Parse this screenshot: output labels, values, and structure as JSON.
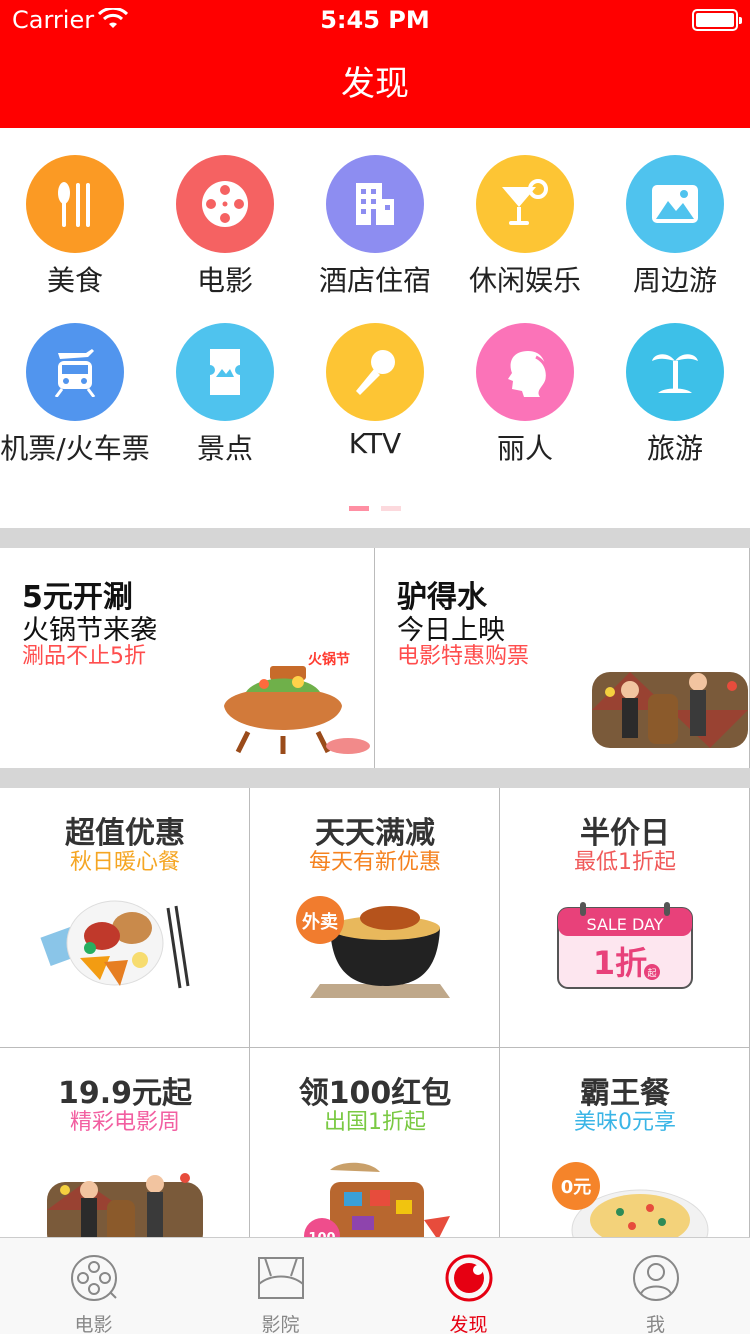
{
  "status_bar": {
    "carrier": "Carrier",
    "time": "5:45 PM"
  },
  "nav": {
    "title": "发现"
  },
  "categories": [
    {
      "label": "美食",
      "icon": "fork-knife-icon",
      "color": "#fb9a24"
    },
    {
      "label": "电影",
      "icon": "film-reel-icon",
      "color": "#f56262"
    },
    {
      "label": "酒店住宿",
      "icon": "hotel-icon",
      "color": "#8d8df1"
    },
    {
      "label": "休闲娱乐",
      "icon": "cocktail-icon",
      "color": "#fdc534"
    },
    {
      "label": "周边游",
      "icon": "landscape-icon",
      "color": "#4fc3ee"
    },
    {
      "label": "机票/火车票",
      "icon": "plane-train-icon",
      "color": "#5195ee"
    },
    {
      "label": "景点",
      "icon": "ticket-icon",
      "color": "#4fc3ee"
    },
    {
      "label": "KTV",
      "icon": "microphone-icon",
      "color": "#fdc534"
    },
    {
      "label": "丽人",
      "icon": "woman-profile-icon",
      "color": "#fb73b8"
    },
    {
      "label": "旅游",
      "icon": "palm-tree-icon",
      "color": "#3dc0e8"
    }
  ],
  "page_indicator": {
    "current": 1,
    "total": 2,
    "active_color": "#ff8fa3",
    "inactive_color": "#fcd9dd"
  },
  "promos": [
    {
      "title": "5元开涮",
      "subtitle": "火锅节来袭",
      "note": "涮品不止5折",
      "image": "hotpot-image",
      "image_caption": "火锅节"
    },
    {
      "title": "驴得水",
      "subtitle": "今日上映",
      "note": "电影特惠购票",
      "image": "movie-poster-image"
    }
  ],
  "deals": [
    {
      "title": "超值优惠",
      "subtitle": "秋日暖心餐",
      "color": "#f5a623",
      "image": "meal-plate-image"
    },
    {
      "title": "天天满减",
      "subtitle": "每天有新优惠",
      "color": "#f5821f",
      "image": "takeout-noodle-image",
      "badge": "外卖"
    },
    {
      "title": "半价日",
      "subtitle": "最低1折起",
      "color": "#f05a5a",
      "image": "sale-day-calendar-image",
      "card_top": "SALE DAY",
      "card_main": "1折",
      "card_small": "起"
    },
    {
      "title": "19.9元起",
      "subtitle": "精彩电影周",
      "color": "#f25fa1",
      "image": "movie-week-image"
    },
    {
      "title": "领100红包",
      "subtitle": "出国1折起",
      "color": "#7ac943",
      "image": "suitcase-image",
      "badge": "100"
    },
    {
      "title": "霸王餐",
      "subtitle": "美味0元享",
      "color": "#3ab5e6",
      "image": "pasta-image",
      "badge": "0元"
    }
  ],
  "tabs": [
    {
      "label": "电影",
      "icon": "film-reel-tab-icon",
      "active": false
    },
    {
      "label": "影院",
      "icon": "cinema-screen-tab-icon",
      "active": false
    },
    {
      "label": "发现",
      "icon": "discover-tab-icon",
      "active": true
    },
    {
      "label": "我",
      "icon": "profile-tab-icon",
      "active": false
    }
  ]
}
